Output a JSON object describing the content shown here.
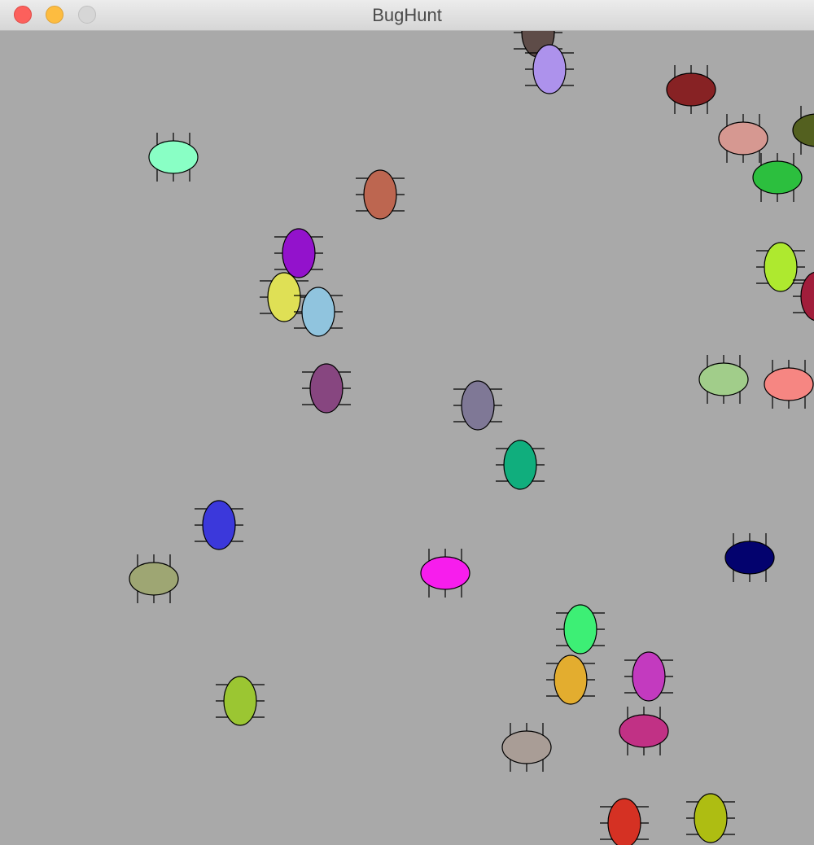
{
  "window": {
    "title": "BugHunt",
    "controls": {
      "close": "close-icon",
      "minimize": "minimize-icon",
      "zoom": "zoom-icon"
    }
  },
  "game": {
    "background_color": "#a9a9a9",
    "bugs": [
      {
        "color": "#5e4c48",
        "orientation": "vertical"
      },
      {
        "color": "#ad92ec",
        "orientation": "vertical"
      },
      {
        "color": "#872224",
        "orientation": "horizontal"
      },
      {
        "color": "#d69891",
        "orientation": "horizontal"
      },
      {
        "color": "#53601f",
        "orientation": "horizontal"
      },
      {
        "color": "#2cbf3e",
        "orientation": "horizontal"
      },
      {
        "color": "#89ffc5",
        "orientation": "horizontal"
      },
      {
        "color": "#bd6650",
        "orientation": "vertical"
      },
      {
        "color": "#9312cc",
        "orientation": "vertical"
      },
      {
        "color": "#dfe055",
        "orientation": "vertical"
      },
      {
        "color": "#90c4de",
        "orientation": "vertical"
      },
      {
        "color": "#aee92f",
        "orientation": "vertical"
      },
      {
        "color": "#a11d3b",
        "orientation": "vertical"
      },
      {
        "color": "#874680",
        "orientation": "vertical"
      },
      {
        "color": "#7f7896",
        "orientation": "vertical"
      },
      {
        "color": "#a1cd8a",
        "orientation": "horizontal"
      },
      {
        "color": "#f68682",
        "orientation": "horizontal"
      },
      {
        "color": "#10ae7d",
        "orientation": "vertical"
      },
      {
        "color": "#3b38db",
        "orientation": "vertical"
      },
      {
        "color": "#9ea673",
        "orientation": "horizontal"
      },
      {
        "color": "#f71ded",
        "orientation": "horizontal"
      },
      {
        "color": "#03026e",
        "orientation": "horizontal"
      },
      {
        "color": "#3def75",
        "orientation": "vertical"
      },
      {
        "color": "#e3ad2f",
        "orientation": "vertical"
      },
      {
        "color": "#c33abf",
        "orientation": "vertical"
      },
      {
        "color": "#9bc632",
        "orientation": "vertical"
      },
      {
        "color": "#c13185",
        "orientation": "horizontal"
      },
      {
        "color": "#a99d96",
        "orientation": "horizontal"
      },
      {
        "color": "#d53123",
        "orientation": "vertical"
      },
      {
        "color": "#aebd12",
        "orientation": "vertical"
      }
    ]
  }
}
